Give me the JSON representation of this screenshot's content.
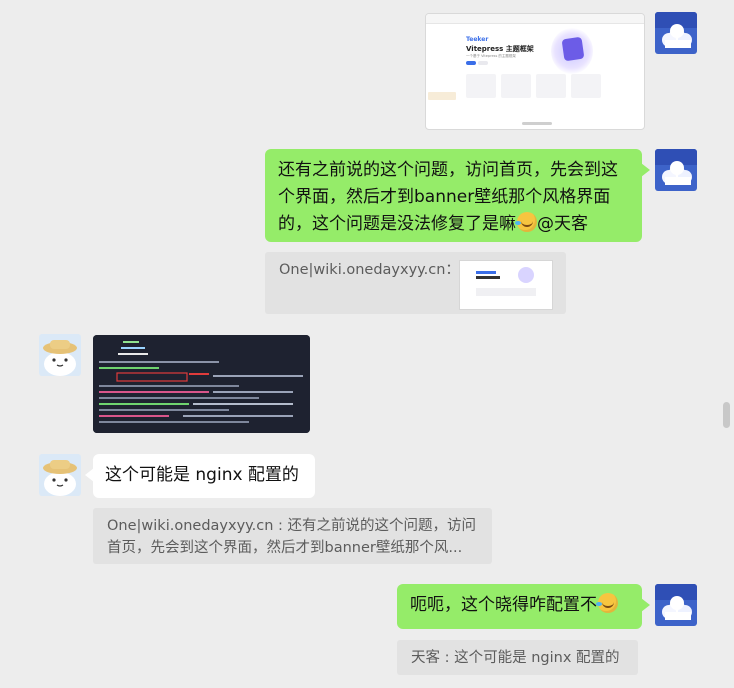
{
  "colors": {
    "background": "#ededed",
    "outgoing_bubble": "#95ec69",
    "incoming_bubble": "#ffffff",
    "quote_bg": "#e2e2e2"
  },
  "messages": [
    {
      "id": 1,
      "side": "right",
      "type": "image",
      "image": {
        "brand": "Teeker",
        "title": "Vitepress 主题框架",
        "subtitle": "一个基于 Vitepress 的主题框架"
      }
    },
    {
      "id": 2,
      "side": "right",
      "type": "text",
      "line1": "还有之前说的这个问题，访问首页，先会到这",
      "line2": "个界面，然后才到banner壁纸那个风格界面",
      "line3": "的，这个问题是没法修复了是嘛",
      "mention": "@天客",
      "emoji": "laugh-cry-emoji",
      "quote": {
        "text": "One|wiki.onedayxyy.cn："
      }
    },
    {
      "id": 3,
      "side": "left",
      "type": "image",
      "image_desc": "terminal-screenshot"
    },
    {
      "id": 4,
      "side": "left",
      "type": "text",
      "text": "这个可能是 nginx 配置的",
      "quote": {
        "line1": "One|wiki.onedayxyy.cn : 还有之前说的这个问题，访问",
        "line2": "首页，先会到这个界面，然后才到banner壁纸那个风..."
      }
    },
    {
      "id": 5,
      "side": "right",
      "type": "text",
      "text": "呃呃，这个晓得咋配置不",
      "emoji": "laugh-cry-emoji",
      "quote": {
        "text": "天客 : 这个可能是 nginx 配置的"
      }
    }
  ]
}
